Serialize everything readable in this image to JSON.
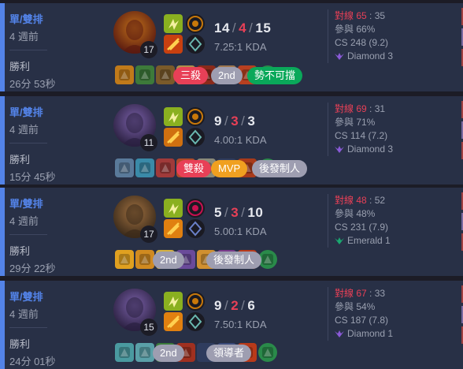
{
  "matches": [
    {
      "queue": "單/雙排",
      "ago": "4 週前",
      "result": "勝利",
      "duration": "26分 53秒",
      "level": "17",
      "kills": "14",
      "deaths": "4",
      "assists": "15",
      "ratio": "7.25:1 KDA",
      "badges": [
        "三殺",
        "2nd",
        "勢不可擋"
      ],
      "kp_label": "對線",
      "kp_a": "65",
      "kp_b": "35",
      "participation": "參與 66%",
      "cs": "CS 248 (9.2)",
      "rank": "Diamond 3",
      "champion_icon": "armored-champion-portrait"
    },
    {
      "queue": "單/雙排",
      "ago": "4 週前",
      "result": "勝利",
      "duration": "15分 45秒",
      "level": "11",
      "kills": "9",
      "deaths": "3",
      "assists": "3",
      "ratio": "4.00:1 KDA",
      "badges": [
        "雙殺",
        "MVP",
        "後發制人"
      ],
      "kp_label": "對線",
      "kp_a": "69",
      "kp_b": "31",
      "participation": "參與 71%",
      "cs": "CS 114 (7.2)",
      "rank": "Diamond 3",
      "champion_icon": "violet-champion-portrait"
    },
    {
      "queue": "單/雙排",
      "ago": "4 週前",
      "result": "勝利",
      "duration": "29分 22秒",
      "level": "17",
      "kills": "5",
      "deaths": "3",
      "assists": "10",
      "ratio": "5.00:1 KDA",
      "badges": [
        "2nd",
        "後發制人"
      ],
      "kp_label": "對線",
      "kp_a": "48",
      "kp_b": "52",
      "participation": "參與 48%",
      "cs": "CS 231 (7.9)",
      "rank": "Emerald 1",
      "champion_icon": "bronze-champion-portrait"
    },
    {
      "queue": "單/雙排",
      "ago": "4 週前",
      "result": "勝利",
      "duration": "24分 01秒",
      "level": "15",
      "kills": "9",
      "deaths": "2",
      "assists": "6",
      "ratio": "7.50:1 KDA",
      "badges": [
        "2nd",
        "領導者"
      ],
      "kp_label": "對線",
      "kp_a": "67",
      "kp_b": "33",
      "participation": "參與 54%",
      "cs": "CS 187 (7.8)",
      "rank": "Diamond 1",
      "champion_icon": "violet-champion-portrait"
    }
  ],
  "colors": {
    "win_bar": "#5383e8",
    "card_bg": "#283046",
    "death": "#e84057",
    "badge_red": "#e84057",
    "badge_grey": "#9e9eb1",
    "badge_green": "#0aa85a",
    "badge_gold": "#f0a020"
  }
}
